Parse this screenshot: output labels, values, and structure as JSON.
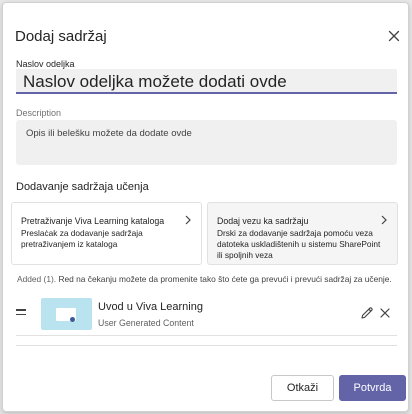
{
  "dialog": {
    "title": "Dodaj sadržaj",
    "close_icon": "close-icon"
  },
  "name_field": {
    "label": "Naslov odeljka",
    "value": "Naslov odeljka možete dodati ovde"
  },
  "description_field": {
    "label": "Description",
    "value": "Opis ili belešku možete da dodate ovde"
  },
  "learning_section": {
    "title": "Dodavanje sadržaja učenja",
    "cards": [
      {
        "title": "Pretraživanje Viva Learning kataloga",
        "description": "Preslaċak za dodavanje sadržaja pretraživanjem iz kataloga"
      },
      {
        "title": "Dodaj vezu ka sadržaju",
        "description": "Drski za dodavanje sadržaja pomoću veza datoteka uskladištenih u sistemu SharePoint ili spoljnih veza"
      }
    ]
  },
  "added": {
    "count_label": "Added (1).",
    "note": "Red na čekanju možete da promenite tako što ćete ga prevući i prevući sadržaj za učenje.",
    "items": [
      {
        "title": "Uvod u Viva Learning",
        "subtitle": "User Generated Content"
      }
    ]
  },
  "footer": {
    "cancel_label": "Otkaži",
    "confirm_label": "Potvrda"
  },
  "colors": {
    "accent": "#6264a7",
    "thumbnail": "#b9e3ee"
  }
}
